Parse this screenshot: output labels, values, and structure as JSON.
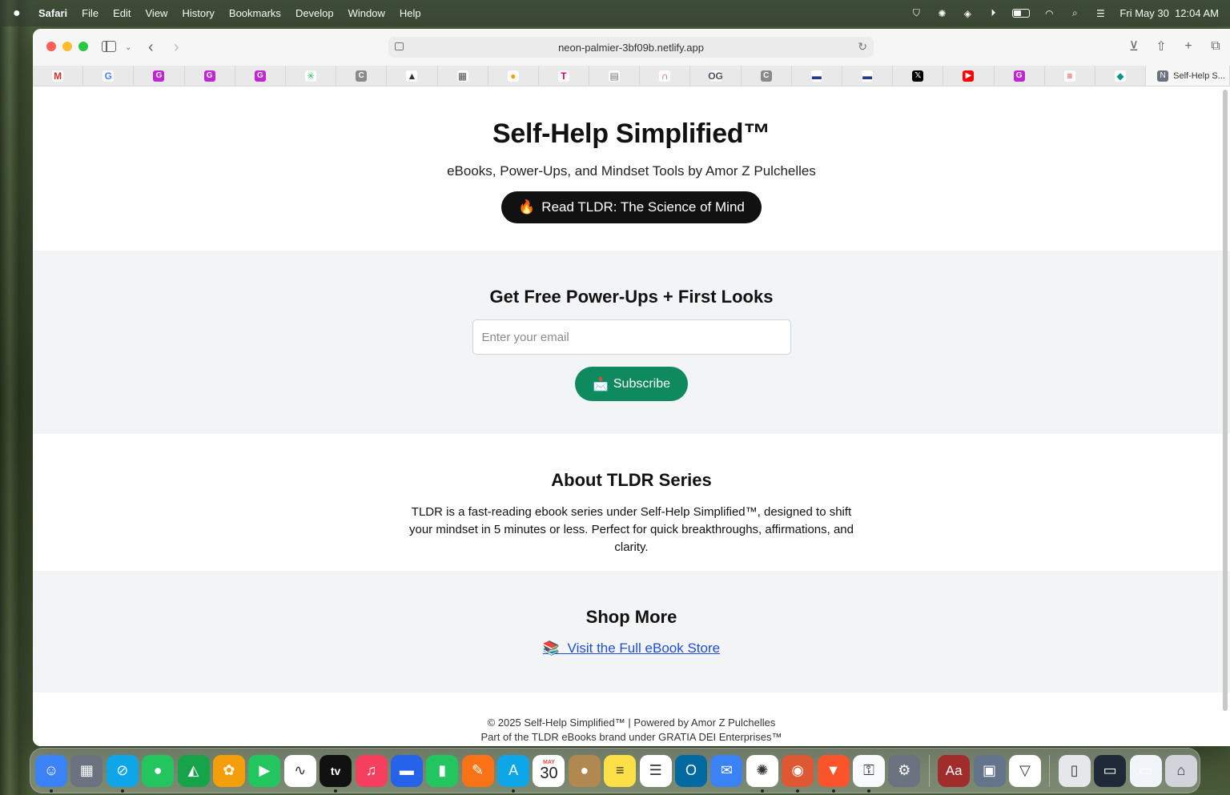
{
  "menubar": {
    "apple_icon": "apple-logo-icon",
    "app_name": "Safari",
    "items": [
      "File",
      "Edit",
      "View",
      "History",
      "Bookmarks",
      "Develop",
      "Window",
      "Help"
    ],
    "date": "Fri May 30",
    "time": "12:04 AM",
    "status_icons": [
      "vpn-icon",
      "chatgpt-icon",
      "layers-icon",
      "play-icon",
      "battery-icon",
      "wifi-icon",
      "spotlight-search-icon",
      "control-center-icon"
    ]
  },
  "browser": {
    "url": "neon-palmier-3bf09b.netlify.app",
    "active_tab_title": "Self-Help S...",
    "favorites": [
      {
        "icon": "gmail-icon",
        "glyph": "M",
        "color": "#ffffff",
        "fg": "#d93025"
      },
      {
        "icon": "google-icon",
        "glyph": "G",
        "color": "#ffffff",
        "fg": "#4285f4"
      },
      {
        "icon": "grammarly-g-icon",
        "glyph": "G",
        "color": "#c026d3",
        "fg": "#ffffff"
      },
      {
        "icon": "grammarly-g-icon",
        "glyph": "G",
        "color": "#c026d3",
        "fg": "#ffffff"
      },
      {
        "icon": "grammarly-g-icon",
        "glyph": "G",
        "color": "#c026d3",
        "fg": "#ffffff"
      },
      {
        "icon": "palm-tree-icon",
        "glyph": "✳",
        "color": "#ffffff",
        "fg": "#22c55e"
      },
      {
        "icon": "c-letter-icon",
        "glyph": "C",
        "color": "#8a8a8a",
        "fg": "#ffffff"
      },
      {
        "icon": "arrow-logo-icon",
        "glyph": "▲",
        "color": "#ffffff",
        "fg": "#333333"
      },
      {
        "icon": "news-logo-icon",
        "glyph": "▦",
        "color": "#ffffff",
        "fg": "#4b5563"
      },
      {
        "icon": "shell-icon",
        "glyph": "●",
        "color": "#ffffff",
        "fg": "#f59e0b"
      },
      {
        "icon": "t-mobile-icon",
        "glyph": "T",
        "color": "#ffffff",
        "fg": "#e20074"
      },
      {
        "icon": "news-site-icon",
        "glyph": "▤",
        "color": "#ffffff",
        "fg": "#6b7280"
      },
      {
        "icon": "arc-logo-icon",
        "glyph": "∩",
        "color": "#ffffff",
        "fg": "#dc2626"
      },
      {
        "icon": "og-logo-icon",
        "glyph": "OG",
        "color": "#ffffff",
        "fg": "#4b5563"
      },
      {
        "icon": "c-letter-icon",
        "glyph": "C",
        "color": "#8a8a8a",
        "fg": "#ffffff"
      },
      {
        "icon": "flag-icon",
        "glyph": "▬",
        "color": "#ffffff",
        "fg": "#1e3a8a"
      },
      {
        "icon": "flag-icon",
        "glyph": "▬",
        "color": "#ffffff",
        "fg": "#1e3a8a"
      },
      {
        "icon": "x-twitter-icon",
        "glyph": "𝕏",
        "color": "#000000",
        "fg": "#ffffff"
      },
      {
        "icon": "youtube-icon",
        "glyph": "▶",
        "color": "#ff0000",
        "fg": "#ffffff"
      },
      {
        "icon": "grammarly-g-icon",
        "glyph": "G",
        "color": "#c026d3",
        "fg": "#ffffff"
      },
      {
        "icon": "red-bars-icon",
        "glyph": "≡",
        "color": "#ffffff",
        "fg": "#dc2626"
      },
      {
        "icon": "diamond-icon",
        "glyph": "◆",
        "color": "#ffffff",
        "fg": "#0d9488"
      }
    ]
  },
  "hero": {
    "title": "Self-Help Simplified™",
    "subtitle": "eBooks, Power-Ups, and Mindset Tools by Amor Z Pulchelles",
    "cta_emoji": "🔥",
    "cta_label": "Read TLDR: The Science of Mind"
  },
  "subscribe": {
    "heading": "Get Free Power-Ups + First Looks",
    "email_placeholder": "Enter your email",
    "button_emoji": "📩",
    "button_label": "Subscribe"
  },
  "about": {
    "heading": "About TLDR Series",
    "body": "TLDR is a fast-reading ebook series under Self-Help Simplified™, designed to shift your mindset in 5 minutes or less. Perfect for quick breakthroughs, affirmations, and clarity."
  },
  "shop": {
    "heading": "Shop More",
    "link_emoji": "📚",
    "link_label": "Visit the Full eBook Store"
  },
  "footer": {
    "line1": "© 2025 Self-Help Simplified™ | Powered by Amor Z Pulchelles",
    "line2": "Part of the TLDR eBooks brand under GRATIA DEI Enterprises™"
  },
  "dock": {
    "calendar_month": "MAY",
    "calendar_day": "30",
    "tv_label": "tv",
    "dictionary_label": "Aa",
    "apps": [
      {
        "name": "finder-icon",
        "color": "#3b82f6",
        "running": true
      },
      {
        "name": "launchpad-icon",
        "color": "#6b7280",
        "running": false
      },
      {
        "name": "safari-icon",
        "color": "#0ea5e9",
        "running": true
      },
      {
        "name": "messages-icon",
        "color": "#22c55e",
        "running": false
      },
      {
        "name": "maps-icon",
        "color": "#16a34a",
        "running": false
      },
      {
        "name": "photos-icon",
        "color": "#f59e0b",
        "running": false
      },
      {
        "name": "facetime-icon",
        "color": "#22c55e",
        "running": false
      },
      {
        "name": "freeform-icon",
        "color": "#ffffff",
        "running": false
      },
      {
        "name": "apple-tv-icon",
        "color": "#111111",
        "running": true
      },
      {
        "name": "music-icon",
        "color": "#f43f5e",
        "running": false
      },
      {
        "name": "keynote-icon",
        "color": "#2563eb",
        "running": false
      },
      {
        "name": "numbers-icon",
        "color": "#22c55e",
        "running": false
      },
      {
        "name": "pages-icon",
        "color": "#f97316",
        "running": false
      },
      {
        "name": "app-store-icon",
        "color": "#0ea5e9",
        "running": true
      },
      {
        "name": "calendar-icon",
        "color": "#ffffff",
        "running": false
      },
      {
        "name": "contacts-icon",
        "color": "#b08850",
        "running": false
      },
      {
        "name": "notes-icon",
        "color": "#fde047",
        "running": false
      },
      {
        "name": "reminders-icon",
        "color": "#ffffff",
        "running": false
      },
      {
        "name": "outlook-icon",
        "color": "#0369a1",
        "running": false
      },
      {
        "name": "mail-icon",
        "color": "#3b82f6",
        "running": false
      },
      {
        "name": "chatgpt-icon",
        "color": "#ffffff",
        "running": true
      },
      {
        "name": "duckduckgo-icon",
        "color": "#de5833",
        "running": true
      },
      {
        "name": "brave-icon",
        "color": "#fb542b",
        "running": true
      },
      {
        "name": "passwords-icon",
        "color": "#f8fafc",
        "running": true
      },
      {
        "name": "system-settings-icon",
        "color": "#6b7280",
        "running": false
      },
      {
        "name": "dictionary-icon",
        "color": "#a02c2c",
        "running": false
      },
      {
        "name": "preview-icon",
        "color": "#64748b",
        "running": false
      },
      {
        "name": "proton-vpn-icon",
        "color": "#ffffff",
        "running": false
      },
      {
        "name": "document-icon",
        "color": "#e5e7eb",
        "running": false
      },
      {
        "name": "screenshot-window-icon",
        "color": "#1f2937",
        "running": false
      },
      {
        "name": "screenshot-window-icon",
        "color": "#f1f5f9",
        "running": false
      },
      {
        "name": "trash-icon",
        "color": "#d1d5db",
        "running": false
      }
    ]
  }
}
